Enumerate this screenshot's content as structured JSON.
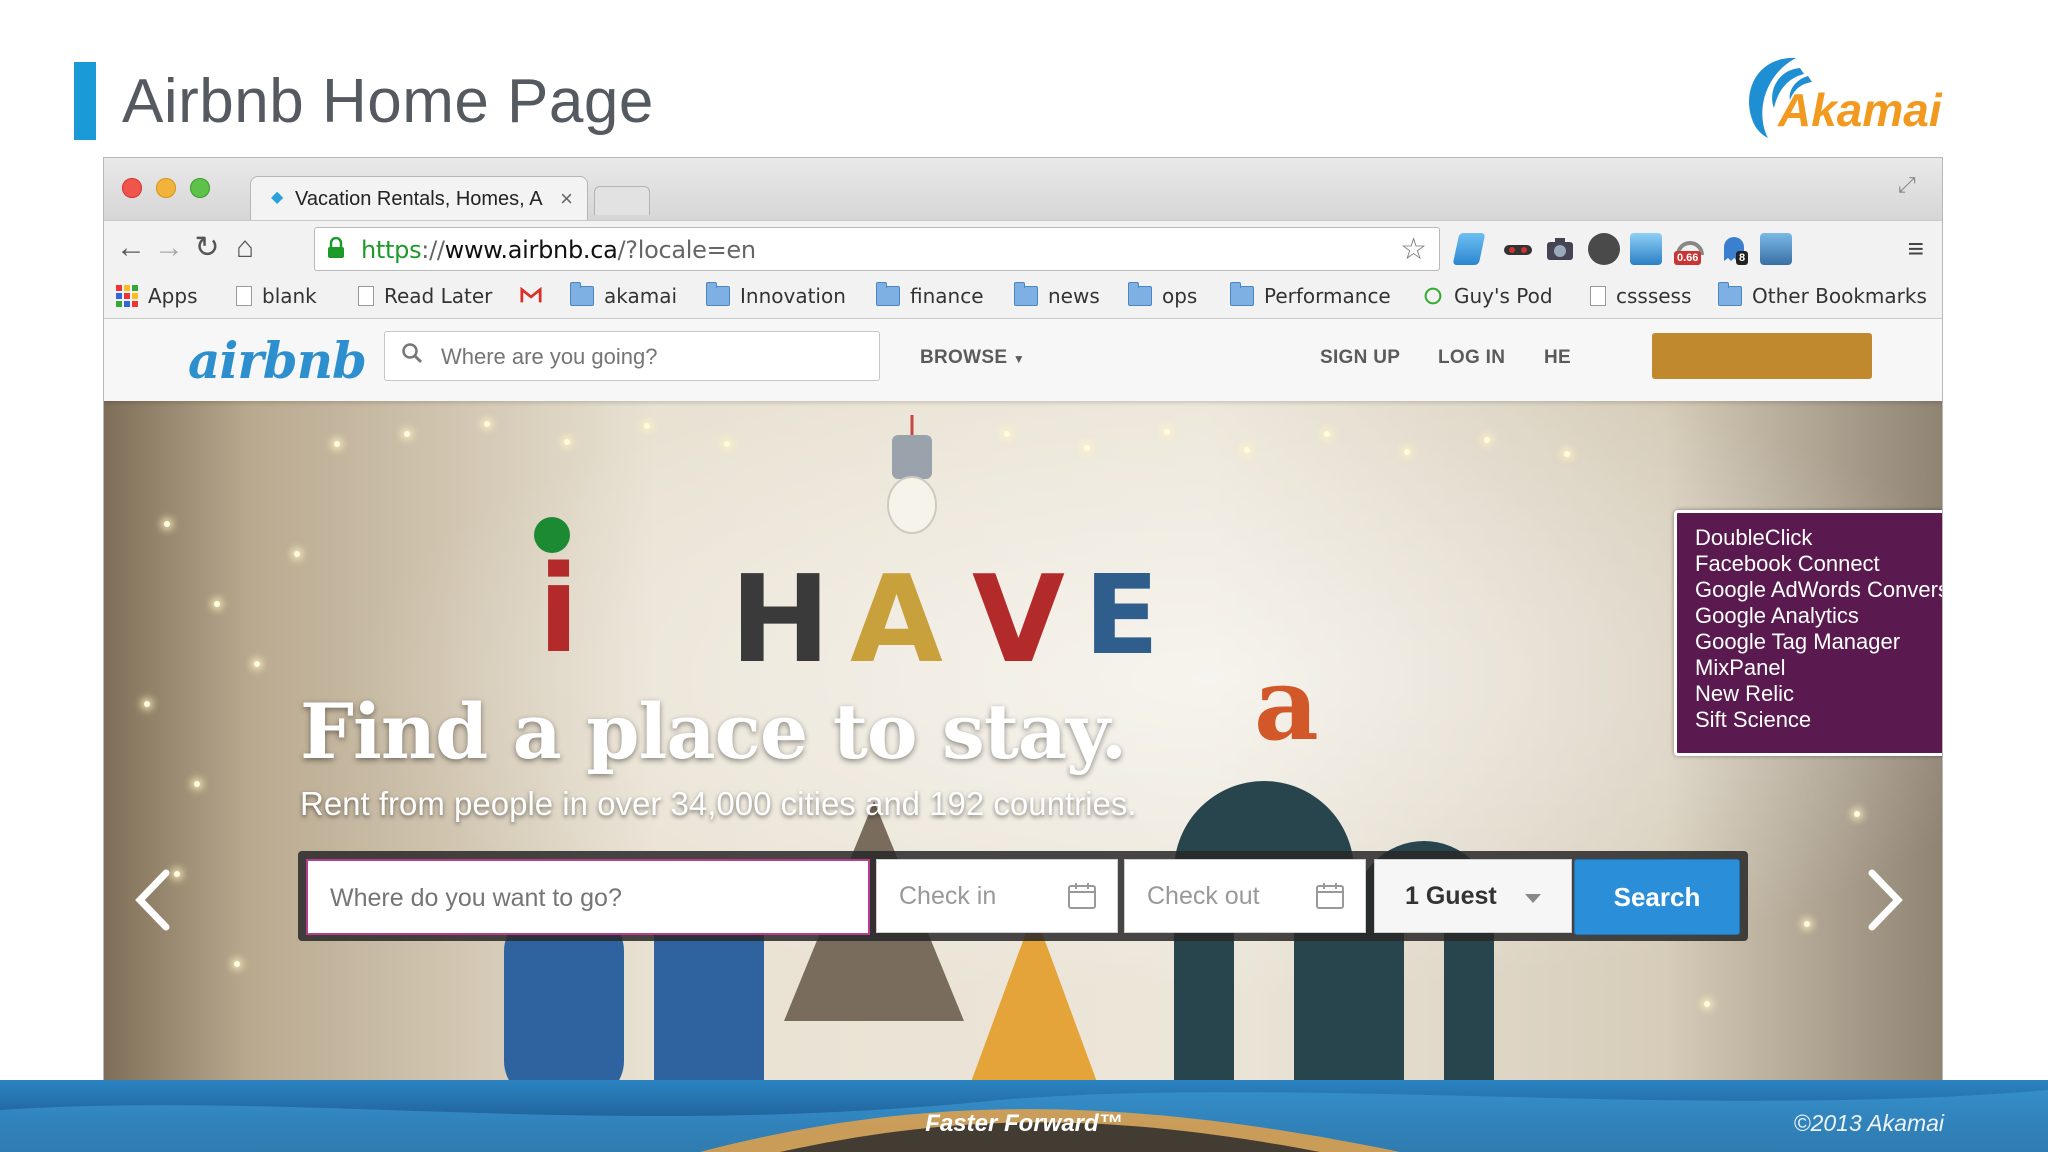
{
  "slide": {
    "title": "Airbnb Home Page",
    "logo_text": "Akamai",
    "footer_tagline": "Faster Forward™",
    "footer_copyright": "©2013 Akamai",
    "colors": {
      "accent_bar": "#1a9ad6",
      "logo_orange": "#f29a1f",
      "logo_blue": "#1f8fd3"
    }
  },
  "browser": {
    "tab_title": "Vacation Rentals, Homes, A",
    "url": {
      "scheme": "https",
      "separator": "://",
      "host": "www.airbnb.ca",
      "path": "/?locale=en"
    },
    "extension_badges": {
      "speed": "0.66",
      "count": "8"
    },
    "bookmarks": [
      {
        "label": "Apps",
        "icon": "apps-grid-icon"
      },
      {
        "label": "blank",
        "icon": "page-icon"
      },
      {
        "label": "Read Later",
        "icon": "page-icon"
      },
      {
        "label": "",
        "icon": "gmail-icon"
      },
      {
        "label": "akamai",
        "icon": "folder-icon"
      },
      {
        "label": "Innovation",
        "icon": "folder-icon"
      },
      {
        "label": "finance",
        "icon": "folder-icon"
      },
      {
        "label": "news",
        "icon": "folder-icon"
      },
      {
        "label": "ops",
        "icon": "folder-icon"
      },
      {
        "label": "Performance",
        "icon": "folder-icon"
      },
      {
        "label": "Guy's Pod",
        "icon": "site-icon"
      },
      {
        "label": "csssess",
        "icon": "page-icon"
      },
      {
        "label": "Other Bookmarks",
        "icon": "folder-icon"
      }
    ]
  },
  "airbnb": {
    "logo": "airbnb",
    "header_search_placeholder": "Where are you going?",
    "nav": {
      "browse": "BROWSE",
      "sign_up": "SIGN UP",
      "log_in": "LOG IN",
      "help": "HE"
    },
    "hero": {
      "decor_letters": [
        "i",
        "H",
        "A",
        "V",
        "E",
        "a"
      ],
      "title": "Find a place to stay.",
      "subtitle": "Rent from people in over 34,000 cities and 192 countries."
    },
    "search": {
      "where_placeholder": "Where do you want to go?",
      "check_in": "Check in",
      "check_out": "Check out",
      "guests": "1 Guest",
      "submit": "Search"
    },
    "colors": {
      "brand_blue": "#2a8ed8",
      "where_border": "#b83d8a"
    }
  },
  "tracker_popup": {
    "background": "#5a1a4f",
    "items": [
      "DoubleClick",
      "Facebook Connect",
      "Google AdWords Conversion",
      "Google Analytics",
      "Google Tag Manager",
      "MixPanel",
      "New Relic",
      "Sift Science"
    ]
  }
}
